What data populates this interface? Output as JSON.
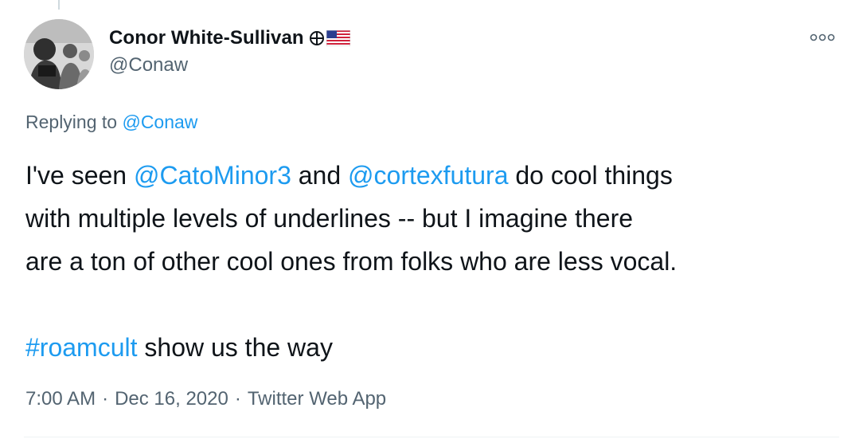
{
  "author": {
    "display_name": "Conor White-Sullivan",
    "handle": "@Conaw",
    "avatar_icon": "profile-photo-icon",
    "badges": [
      "crosshair-circle-icon",
      "us-flag-icon"
    ]
  },
  "menu": {
    "more_icon": "more-options-icon"
  },
  "reply_context": {
    "prefix": "Replying to",
    "handle": "@Conaw"
  },
  "body": {
    "line1_pre": "I've seen",
    "mention1": "@CatoMinor3",
    "line1_mid": "and",
    "mention2": "@cortexfutura",
    "line1_post": "do cool things",
    "line2": "with multiple levels of underlines -- but I imagine there",
    "line3": "are a ton of other cool ones from folks who are less vocal.",
    "hashtag": "#roamcult",
    "line5_post": "show us the way"
  },
  "meta": {
    "time": "7:00 AM",
    "date": "Dec 16, 2020",
    "source": "Twitter Web App",
    "separator": "·"
  },
  "colors": {
    "text": "#0f1419",
    "secondary": "#536471",
    "link": "#1d9bf0"
  }
}
